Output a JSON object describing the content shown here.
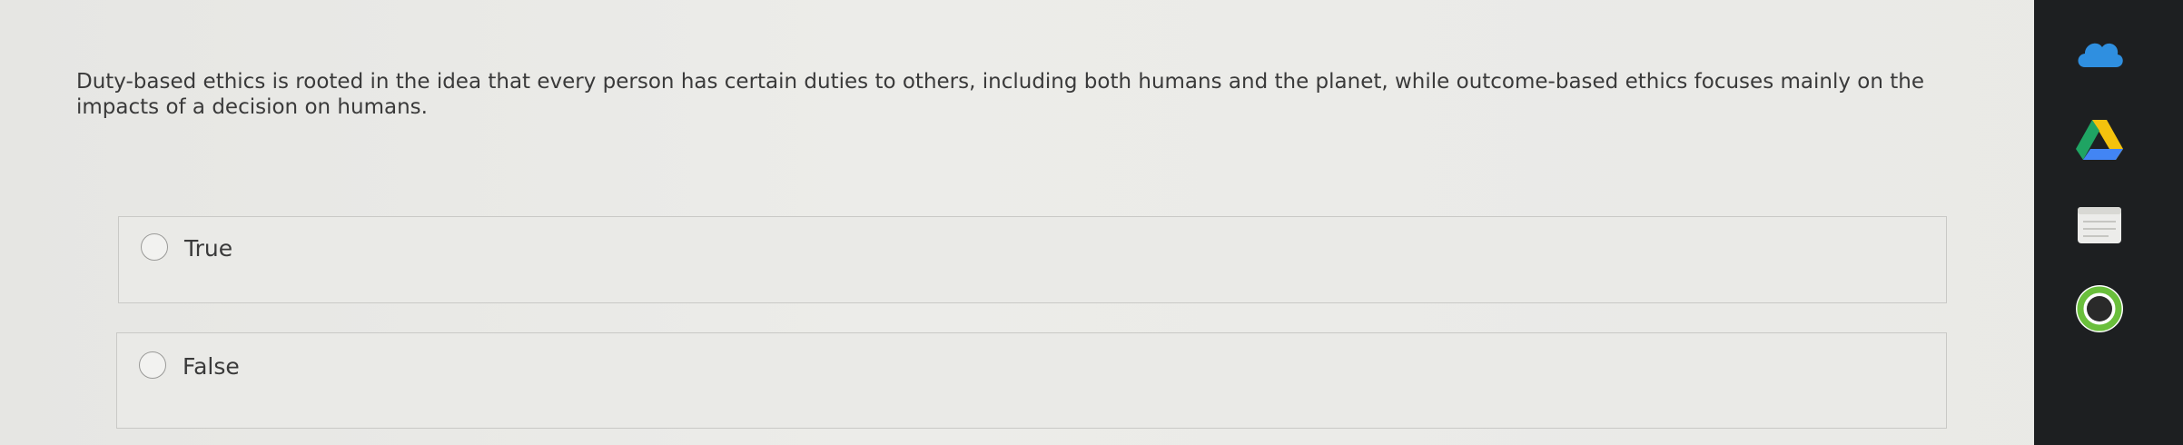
{
  "question": {
    "text": "Duty-based ethics is rooted in the idea that every person has certain duties to others, including both humans and the planet, while outcome-based ethics focuses mainly on the impacts of a decision on humans."
  },
  "options": [
    {
      "label": "True",
      "selected": false
    },
    {
      "label": "False",
      "selected": false
    }
  ],
  "dock": {
    "icons": [
      "cloud-icon",
      "drive-icon",
      "notes-icon",
      "account-circle-icon"
    ]
  },
  "colors": {
    "background": "#e9e9e7",
    "text": "#3a3a3a",
    "option_border": "#c9c9c6",
    "dock": "#1d1f21"
  }
}
